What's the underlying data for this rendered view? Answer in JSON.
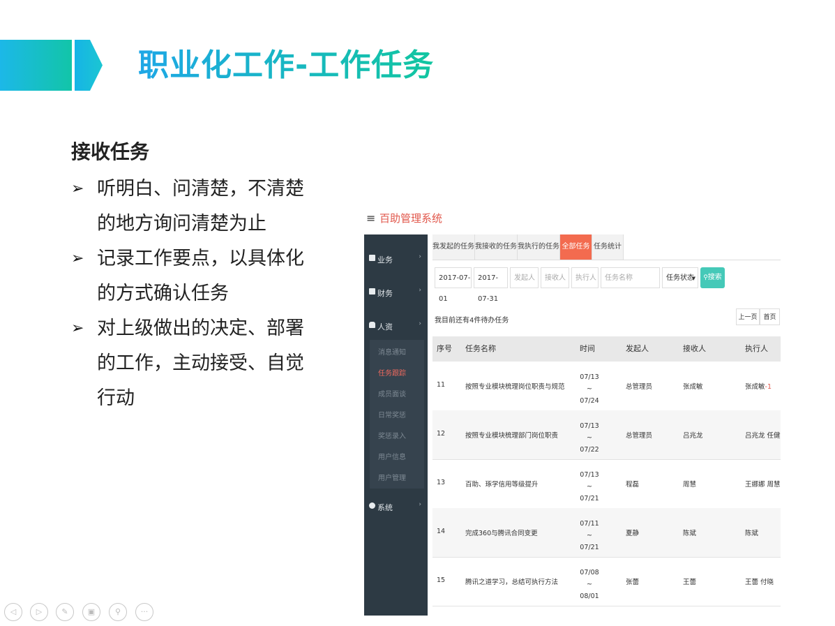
{
  "slide": {
    "title": "职业化工作-工作任务",
    "section_heading": "接收任务",
    "bullets": [
      {
        "line1": "听明白、问清楚，不清楚",
        "line2": "的地方询问清楚为止"
      },
      {
        "line1": "记录工作要点，以具体化",
        "line2": "的方式确认任务"
      },
      {
        "line1": "对上级做出的决定、部署",
        "line2": "的工作，主动接受、自觉",
        "line3": "行动"
      }
    ]
  },
  "app": {
    "menu_icon": "≡",
    "name": "百助管理系统",
    "sidebar": {
      "items": [
        {
          "label": "业务",
          "icon": "book-icon"
        },
        {
          "label": "财务",
          "icon": "calculator-icon"
        },
        {
          "label": "人资",
          "icon": "lock-icon"
        },
        {
          "label": "系统",
          "icon": "gears-icon"
        }
      ],
      "submenu": [
        "消息通知",
        "任务跟踪",
        "成员面谈",
        "日常奖惩",
        "奖惩录入",
        "用户信息",
        "用户管理"
      ],
      "active_sub": "任务跟踪"
    },
    "tabs": [
      "我发起的任务",
      "我接收的任务",
      "我执行的任务",
      "全部任务",
      "任务统计"
    ],
    "active_tab": "全部任务",
    "filters": {
      "start_date": "2017-07-01",
      "end_date": "2017-07-31",
      "initiator_placeholder": "发起人",
      "receiver_placeholder": "接收人",
      "executor_placeholder": "执行人",
      "task_name_placeholder": "任务名称",
      "status_label": "任务状态",
      "search_label": "搜索"
    },
    "pending_note": "我目前还有4件待办任务",
    "pager": {
      "prev": "上一页",
      "first": "首页"
    },
    "table": {
      "headers": [
        "序号",
        "任务名称",
        "时间",
        "发起人",
        "接收人",
        "执行人"
      ],
      "rows": [
        {
          "no": "11",
          "name": "按照专业模块梳理岗位职责与规范",
          "start": "07/13",
          "sep": "~",
          "end": "07/24",
          "initiator": "总管理员",
          "receiver": "张成敏",
          "executor": "张成敏",
          "suffix": "-1"
        },
        {
          "no": "12",
          "name": "按照专业模块梳理部门岗位职责",
          "start": "07/13",
          "sep": "~",
          "end": "07/22",
          "initiator": "总管理员",
          "receiver": "吕兆龙",
          "executor": "吕兆龙 任健",
          "suffix": ""
        },
        {
          "no": "13",
          "name": "百助、琢学信用等级提升",
          "start": "07/13",
          "sep": "~",
          "end": "07/21",
          "initiator": "程磊",
          "receiver": "周慧",
          "executor": "王娜娜 周慧",
          "suffix": ""
        },
        {
          "no": "14",
          "name": "完成360与腾讯合同变更",
          "start": "07/11",
          "sep": "~",
          "end": "07/21",
          "initiator": "夏静",
          "receiver": "陈斌",
          "executor": "陈斌",
          "suffix": ""
        },
        {
          "no": "15",
          "name": "腾讯之道学习，总结可执行方法",
          "start": "07/08",
          "sep": "~",
          "end": "08/01",
          "initiator": "张蕾",
          "receiver": "王蕾",
          "executor": "王蕾 付晓",
          "suffix": ""
        }
      ]
    }
  },
  "slide_nav": {
    "buttons": [
      "previous-slide-icon",
      "next-slide-icon",
      "pen-icon",
      "slides-overview-icon",
      "zoom-icon",
      "more-icon"
    ],
    "more_glyph": "···"
  }
}
